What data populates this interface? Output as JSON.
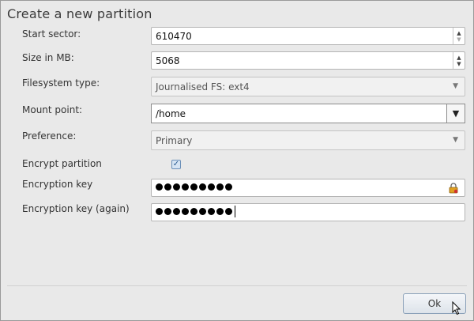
{
  "dialog": {
    "title": "Create a new partition"
  },
  "fields": {
    "start_sector": {
      "label": "Start sector:",
      "value": "610470"
    },
    "size_mb": {
      "label": "Size in MB:",
      "value": "5068"
    },
    "filesystem_type": {
      "label": "Filesystem type:",
      "value": "Journalised FS: ext4"
    },
    "mount_point": {
      "label": "Mount point:",
      "value": "/home"
    },
    "preference": {
      "label": "Preference:",
      "value": "Primary"
    },
    "encrypt_partition": {
      "label": "Encrypt partition",
      "checked": true
    },
    "encryption_key": {
      "label": "Encryption key",
      "masked_length": 9
    },
    "encryption_key_again": {
      "label": "Encryption key (again)",
      "masked_length": 9
    }
  },
  "buttons": {
    "ok_label": "Ok"
  },
  "icons": {
    "spin_up": "spin-up-icon",
    "spin_down": "spin-down-icon",
    "dropdown": "dropdown-arrow-icon",
    "lock": "lock-icon",
    "check": "checkmark-icon",
    "cursor": "mouse-cursor-icon"
  },
  "colors": {
    "dialog_bg": "#e9e9e9",
    "accent": "#6b8fb8"
  }
}
